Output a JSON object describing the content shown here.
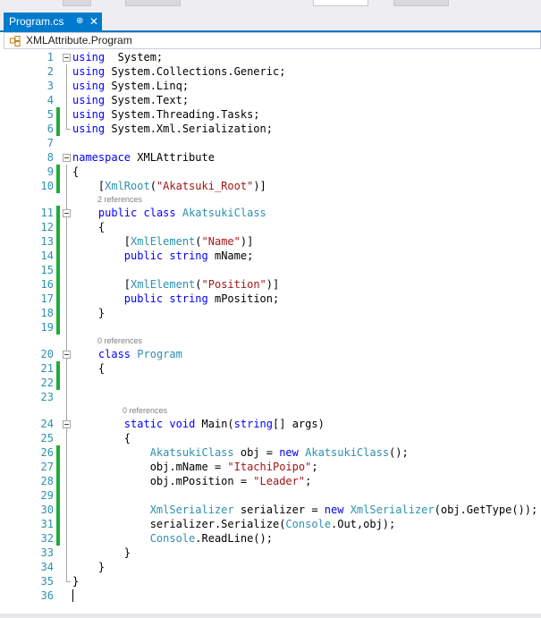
{
  "tab": {
    "title": "Program.cs",
    "pin_glyph": "⊕",
    "close_glyph": "✕"
  },
  "navbar": {
    "scope": "XMLAttribute.Program",
    "icon": "class-icon"
  },
  "colors": {
    "keyword": "#0000ff",
    "type": "#2b91af",
    "string": "#a31515",
    "line_number": "#2b91af",
    "change_marker": "#1fab3a",
    "tab_accent": "#007acc",
    "codelens": "#808080"
  },
  "lines": [
    {
      "n": "1",
      "fold": "start",
      "chg": false,
      "tokens": [
        [
          "kw",
          "using"
        ],
        [
          "",
          "  System;"
        ]
      ]
    },
    {
      "n": "2",
      "fold": "body",
      "chg": false,
      "tokens": [
        [
          "kw",
          "using"
        ],
        [
          "",
          " System.Collections.Generic;"
        ]
      ]
    },
    {
      "n": "3",
      "fold": "body",
      "chg": false,
      "tokens": [
        [
          "kw",
          "using"
        ],
        [
          "",
          " System.Linq;"
        ]
      ]
    },
    {
      "n": "4",
      "fold": "body",
      "chg": false,
      "tokens": [
        [
          "kw",
          "using"
        ],
        [
          "",
          " System.Text;"
        ]
      ]
    },
    {
      "n": "5",
      "fold": "body",
      "chg": true,
      "tokens": [
        [
          "kw",
          "using"
        ],
        [
          "",
          " System.Threading.Tasks;"
        ]
      ]
    },
    {
      "n": "6",
      "fold": "end",
      "chg": true,
      "tokens": [
        [
          "kw",
          "using"
        ],
        [
          "",
          " System.Xml.Serialization;"
        ]
      ]
    },
    {
      "n": "7",
      "fold": "",
      "chg": false,
      "tokens": []
    },
    {
      "n": "8",
      "fold": "start",
      "chg": false,
      "tokens": [
        [
          "kw",
          "namespace"
        ],
        [
          "",
          " XMLAttribute"
        ]
      ]
    },
    {
      "n": "9",
      "fold": "body",
      "chg": true,
      "tokens": [
        [
          "",
          "{"
        ]
      ]
    },
    {
      "n": "10",
      "fold": "body",
      "chg": true,
      "tokens": [
        [
          "",
          "    ["
        ],
        [
          "ty",
          "XmlRoot"
        ],
        [
          "",
          "("
        ],
        [
          "st",
          "\"Akatsuki_Root\""
        ],
        [
          "",
          ")]"
        ]
      ]
    },
    {
      "lens": "2 references",
      "indent": 4
    },
    {
      "n": "11",
      "fold": "start2",
      "chg": true,
      "tokens": [
        [
          "",
          "    "
        ],
        [
          "kw",
          "public"
        ],
        [
          "",
          " "
        ],
        [
          "kw",
          "class"
        ],
        [
          "",
          " "
        ],
        [
          "ty",
          "AkatsukiClass"
        ]
      ]
    },
    {
      "n": "12",
      "fold": "body",
      "chg": true,
      "tokens": [
        [
          "",
          "    {"
        ]
      ]
    },
    {
      "n": "13",
      "fold": "body",
      "chg": true,
      "tokens": [
        [
          "",
          "        ["
        ],
        [
          "ty",
          "XmlElement"
        ],
        [
          "",
          "("
        ],
        [
          "st",
          "\"Name\""
        ],
        [
          "",
          ")]"
        ]
      ]
    },
    {
      "n": "14",
      "fold": "body",
      "chg": true,
      "tokens": [
        [
          "",
          "        "
        ],
        [
          "kw",
          "public"
        ],
        [
          "",
          " "
        ],
        [
          "kw",
          "string"
        ],
        [
          "",
          " mName;"
        ]
      ]
    },
    {
      "n": "15",
      "fold": "body",
      "chg": true,
      "tokens": []
    },
    {
      "n": "16",
      "fold": "body",
      "chg": true,
      "tokens": [
        [
          "",
          "        ["
        ],
        [
          "ty",
          "XmlElement"
        ],
        [
          "",
          "("
        ],
        [
          "st",
          "\"Position\""
        ],
        [
          "",
          ")]"
        ]
      ]
    },
    {
      "n": "17",
      "fold": "body",
      "chg": true,
      "tokens": [
        [
          "",
          "        "
        ],
        [
          "kw",
          "public"
        ],
        [
          "",
          " "
        ],
        [
          "kw",
          "string"
        ],
        [
          "",
          " mPosition;"
        ]
      ]
    },
    {
      "n": "18",
      "fold": "end2",
      "chg": true,
      "tokens": [
        [
          "",
          "    }"
        ]
      ]
    },
    {
      "n": "19",
      "fold": "body",
      "chg": true,
      "tokens": []
    },
    {
      "lens": "0 references",
      "indent": 4
    },
    {
      "n": "20",
      "fold": "start2",
      "chg": false,
      "tokens": [
        [
          "",
          "    "
        ],
        [
          "kw",
          "class"
        ],
        [
          "",
          " "
        ],
        [
          "ty",
          "Program"
        ]
      ]
    },
    {
      "n": "21",
      "fold": "body",
      "chg": true,
      "tokens": [
        [
          "",
          "    {"
        ]
      ]
    },
    {
      "n": "22",
      "fold": "body",
      "chg": true,
      "tokens": []
    },
    {
      "n": "23",
      "fold": "body",
      "chg": false,
      "tokens": []
    },
    {
      "lens": "0 references",
      "indent": 8
    },
    {
      "n": "24",
      "fold": "start3",
      "chg": false,
      "tokens": [
        [
          "",
          "        "
        ],
        [
          "kw",
          "static"
        ],
        [
          "",
          " "
        ],
        [
          "kw",
          "void"
        ],
        [
          "",
          " Main("
        ],
        [
          "kw",
          "string"
        ],
        [
          "",
          "[] args)"
        ]
      ]
    },
    {
      "n": "25",
      "fold": "body",
      "chg": false,
      "tokens": [
        [
          "",
          "        {"
        ]
      ]
    },
    {
      "n": "26",
      "fold": "body",
      "chg": true,
      "tokens": [
        [
          "",
          "            "
        ],
        [
          "ty",
          "AkatsukiClass"
        ],
        [
          "",
          " obj = "
        ],
        [
          "kw",
          "new"
        ],
        [
          "",
          " "
        ],
        [
          "ty",
          "AkatsukiClass"
        ],
        [
          "",
          "();"
        ]
      ]
    },
    {
      "n": "27",
      "fold": "body",
      "chg": true,
      "tokens": [
        [
          "",
          "            obj.mName = "
        ],
        [
          "st",
          "\"ItachiPoipo\""
        ],
        [
          "",
          ";"
        ]
      ]
    },
    {
      "n": "28",
      "fold": "body",
      "chg": true,
      "tokens": [
        [
          "",
          "            obj.mPosition = "
        ],
        [
          "st",
          "\"Leader\""
        ],
        [
          "",
          ";"
        ]
      ]
    },
    {
      "n": "29",
      "fold": "body",
      "chg": true,
      "tokens": []
    },
    {
      "n": "30",
      "fold": "body",
      "chg": true,
      "tokens": [
        [
          "",
          "            "
        ],
        [
          "ty",
          "XmlSerializer"
        ],
        [
          "",
          " serializer = "
        ],
        [
          "kw",
          "new"
        ],
        [
          "",
          " "
        ],
        [
          "ty",
          "XmlSerializer"
        ],
        [
          "",
          "(obj.GetType());"
        ]
      ]
    },
    {
      "n": "31",
      "fold": "body",
      "chg": true,
      "tokens": [
        [
          "",
          "            serializer.Serialize("
        ],
        [
          "ty",
          "Console"
        ],
        [
          "",
          ".Out,obj);"
        ]
      ]
    },
    {
      "n": "32",
      "fold": "body",
      "chg": true,
      "tokens": [
        [
          "",
          "            "
        ],
        [
          "ty",
          "Console"
        ],
        [
          "",
          ".ReadLine();"
        ]
      ]
    },
    {
      "n": "33",
      "fold": "end3",
      "chg": false,
      "tokens": [
        [
          "",
          "        }"
        ]
      ]
    },
    {
      "n": "34",
      "fold": "end2",
      "chg": false,
      "tokens": [
        [
          "",
          "    }"
        ]
      ]
    },
    {
      "n": "35",
      "fold": "end",
      "chg": false,
      "tokens": [
        [
          "",
          "}"
        ]
      ]
    },
    {
      "n": "36",
      "fold": "",
      "chg": false,
      "tokens": [],
      "caret": true
    }
  ]
}
